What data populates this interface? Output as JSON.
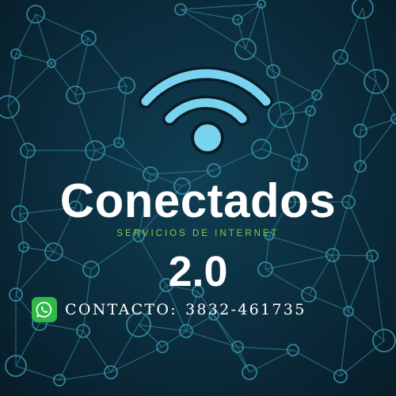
{
  "brand": {
    "title": "Conectados",
    "tagline": "SERVICIOS DE INTERNET",
    "version": "2.0"
  },
  "contact": {
    "label": "CONTACTO:",
    "phone": "3832-461735",
    "icon": "whatsapp-icon"
  },
  "colors": {
    "background": "#0b2c3c",
    "wifi": "#7ad3ee",
    "accent_green": "#7fd041",
    "whatsapp": "#2fb947",
    "network": "#3a93a8",
    "text": "#ffffff"
  }
}
